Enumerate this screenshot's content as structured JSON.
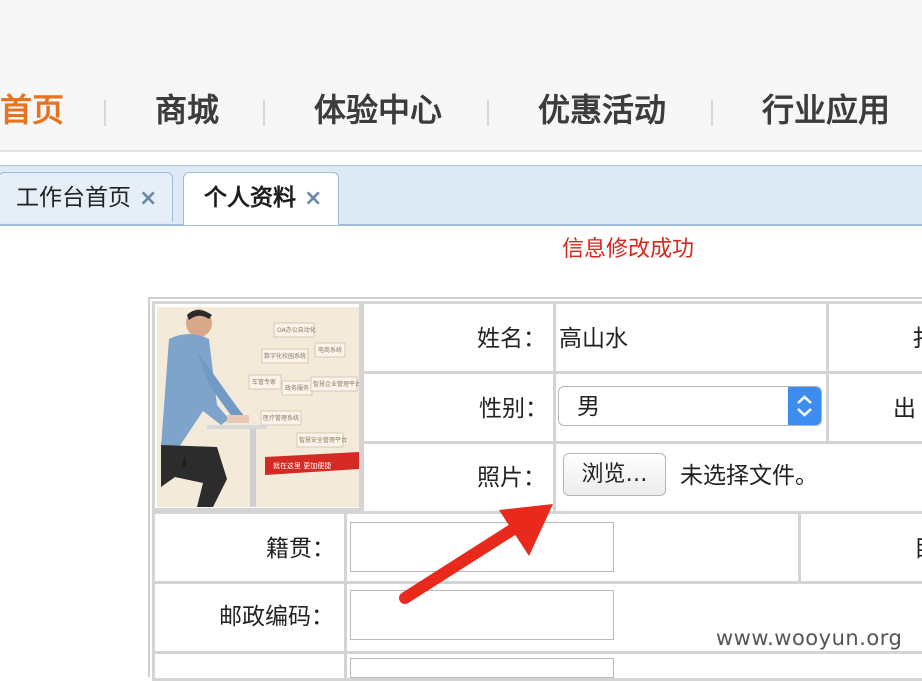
{
  "nav": {
    "items": [
      {
        "label": "首页",
        "active": true
      },
      {
        "label": "商城",
        "active": false
      },
      {
        "label": "体验中心",
        "active": false
      },
      {
        "label": "优惠活动",
        "active": false
      },
      {
        "label": "行业应用",
        "active": false
      }
    ]
  },
  "tabs": [
    {
      "label": "工作台首页",
      "close": "×",
      "active": false
    },
    {
      "label": "个人资料",
      "close": "×",
      "active": true
    }
  ],
  "message": "信息修改成功",
  "form": {
    "name_label": "姓名：",
    "name_value": "高山水",
    "gender_label": "性别：",
    "gender_value": "男",
    "photo_label": "照片：",
    "browse_label": "浏览…",
    "no_file_text": "未选择文件。",
    "hometown_label": "籍贯：",
    "postcode_label": "邮政编码：",
    "right_col_label_1": "扌",
    "right_col_label_2": "出",
    "right_col_label_3": "目"
  },
  "photo_tags": [
    "OA办公自动化",
    "数字化校园系统",
    "电商系统",
    "车管专家",
    "政务服务",
    "智慧企业管理平台",
    "医疗管理系统",
    "智慧安全管理平台"
  ],
  "banner_text": "就在这里 更加便捷",
  "watermark": "www.wooyun.org",
  "colors": {
    "nav_active": "#e8731f",
    "message": "#d9261c",
    "select_arrow": "#3b8ef0",
    "arrow": "#e8291c"
  }
}
